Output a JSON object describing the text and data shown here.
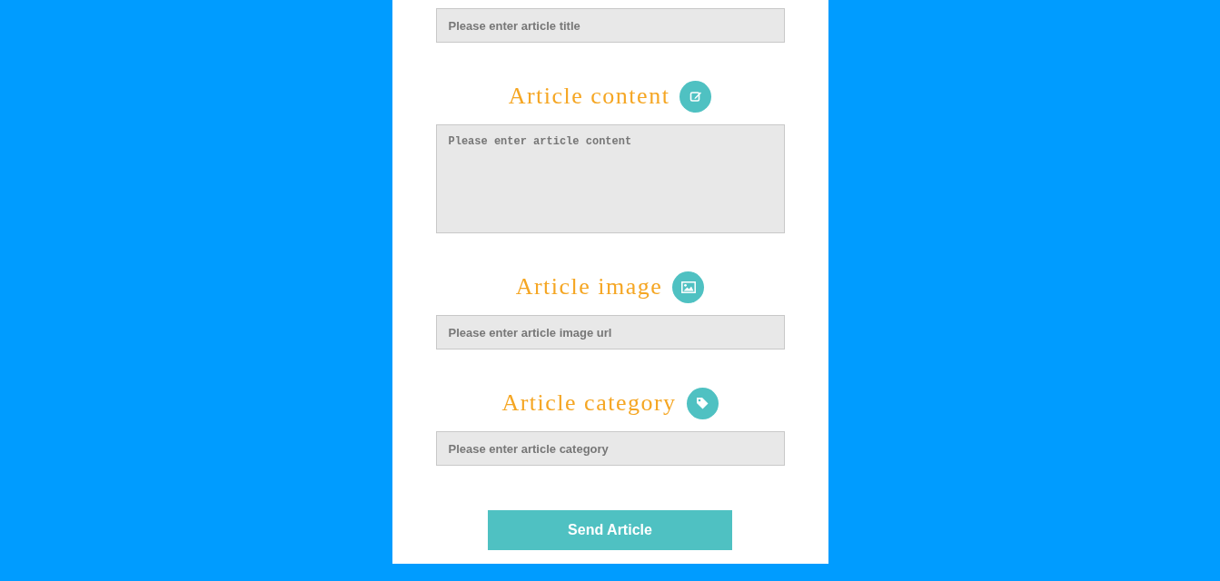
{
  "fields": [
    {
      "kind": "input",
      "placeholder": "Please enter article title"
    },
    {
      "kind": "textarea",
      "heading": "Article content",
      "placeholder": "Please enter article content"
    },
    {
      "kind": "input",
      "heading": "Article image",
      "placeholder": "Please enter article image url"
    },
    {
      "kind": "input",
      "heading": "Article category",
      "placeholder": "Please enter article category"
    }
  ],
  "submit": "Send Article"
}
